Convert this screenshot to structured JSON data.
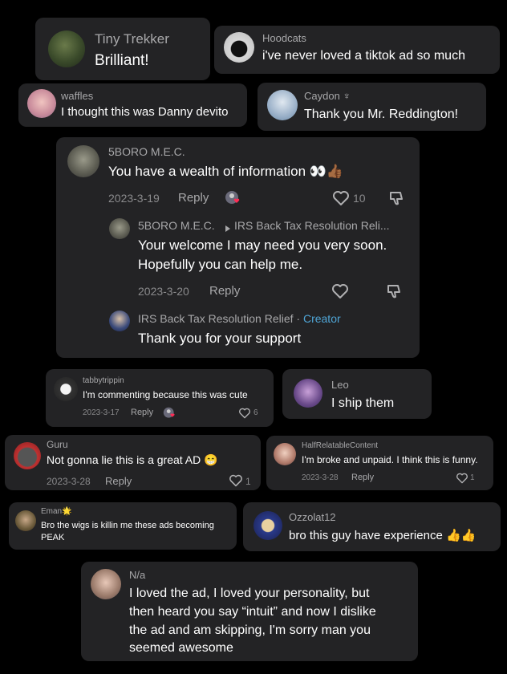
{
  "comments": {
    "c1": {
      "name": "Tiny Trekker",
      "text": "Brilliant!"
    },
    "c2": {
      "name": "Hoodcats",
      "text": "i've never loved a tiktok ad so much"
    },
    "c3": {
      "name": "waffles",
      "text": "I thought this was Danny devito"
    },
    "c4": {
      "name": "Caydon ♆",
      "text": "Thank you Mr. Reddington!"
    },
    "c5": {
      "name": "5BORO M.E.C.",
      "text": "You have a wealth of information 👀👍🏾",
      "date": "2023-3-19",
      "reply_label": "Reply",
      "likes": "10",
      "reply1": {
        "name": "5BORO M.E.C.",
        "reply_to": "IRS Back Tax Resolution Reli...",
        "line1": "Your welcome I may need you very soon.",
        "line2": "Hopefully you can help me.",
        "date": "2023-3-20",
        "reply_label": "Reply"
      },
      "reply2": {
        "name": "IRS Back Tax Resolution Relief",
        "separator": " · ",
        "badge": "Creator",
        "text": "Thank you for your support"
      }
    },
    "c6": {
      "name": "tabbytrippin",
      "text": "I'm commenting because this was cute",
      "date": "2023-3-17",
      "reply_label": "Reply",
      "likes": "6"
    },
    "c7": {
      "name": "Leo",
      "text": "I ship them"
    },
    "c8": {
      "name": "Guru",
      "text": "Not gonna lie this is a great AD 😁",
      "date": "2023-3-28",
      "reply_label": "Reply",
      "likes": "1"
    },
    "c9": {
      "name": "HalfRelatableContent",
      "text": "I'm broke and unpaid. I think this is funny.",
      "date": "2023-3-28",
      "reply_label": "Reply",
      "likes": "1"
    },
    "c10": {
      "name": "Eman🌟",
      "text": "Bro the wigs is killin me these ads becoming PEAK"
    },
    "c11": {
      "name": "Ozzolat12",
      "text": "bro this guy have experience 👍👍"
    },
    "c12": {
      "name": "N/a",
      "line1": "I loved the ad, I loved your personality, but",
      "line2": "then heard you say “intuit” and now I dislike",
      "line3": "the ad and am skipping, I'm sorry man you",
      "line4": "seemed awesome"
    }
  },
  "colors": {
    "background": "#000000",
    "card": "#232325",
    "creator": "#4fa5d6",
    "like_badge": "#fe2c55"
  },
  "icons": [
    "heart-outline-icon",
    "thumbs-down-icon",
    "liked-by-creator-icon",
    "reply-arrow-icon"
  ]
}
